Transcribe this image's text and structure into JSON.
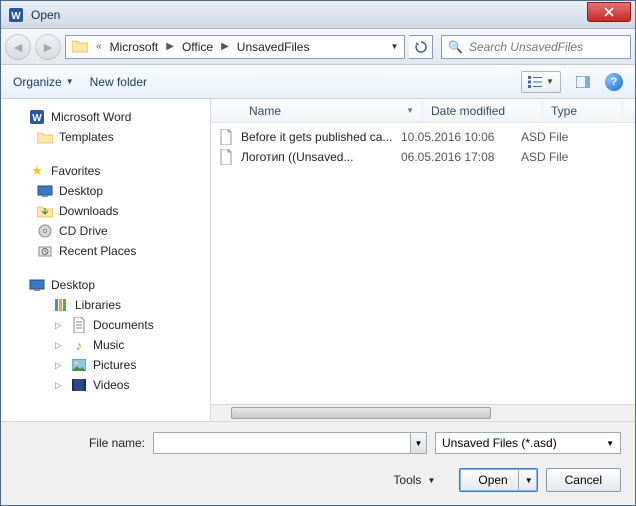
{
  "title": "Open",
  "breadcrumb": {
    "items": [
      "Microsoft",
      "Office",
      "UnsavedFiles"
    ]
  },
  "search": {
    "placeholder": "Search UnsavedFiles"
  },
  "toolbar": {
    "organize": "Organize",
    "new_folder": "New folder"
  },
  "columns": {
    "name": "Name",
    "date": "Date modified",
    "type": "Type"
  },
  "sidebar": {
    "word": "Microsoft Word",
    "templates": "Templates",
    "favorites": "Favorites",
    "desktop": "Desktop",
    "downloads": "Downloads",
    "cddrive": "CD Drive",
    "recent": "Recent Places",
    "desktop2": "Desktop",
    "libraries": "Libraries",
    "documents": "Documents",
    "music": "Music",
    "pictures": "Pictures",
    "videos": "Videos"
  },
  "files": [
    {
      "name": "Before it gets published ca...",
      "date": "10.05.2016 10:06",
      "type": "ASD File"
    },
    {
      "name": "Логотип        ((Unsaved...",
      "date": "06.05.2016 17:08",
      "type": "ASD File"
    }
  ],
  "footer": {
    "filename_label": "File name:",
    "filter": "Unsaved Files (*.asd)",
    "tools": "Tools",
    "open": "Open",
    "cancel": "Cancel"
  }
}
